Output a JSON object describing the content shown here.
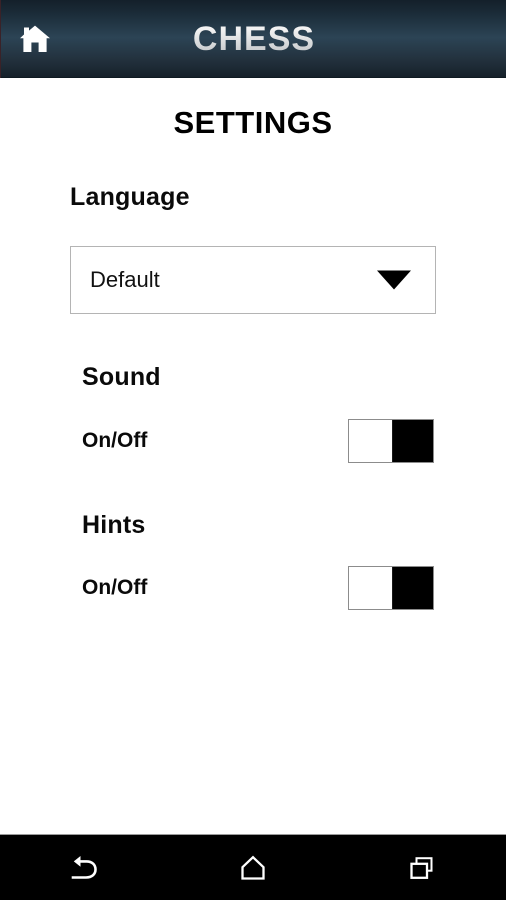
{
  "header": {
    "title": "CHESS",
    "home_icon": "home-icon",
    "bg_top_color": "#14202a",
    "bg_mid_color": "#2c4455",
    "bg_bottom_color": "#152029"
  },
  "page": {
    "title": "SETTINGS",
    "background": "#ffffff",
    "text_color": "#000000"
  },
  "sections": {
    "language": {
      "heading": "Language",
      "select": {
        "value": "Default",
        "placeholder": "Default",
        "chevron_icon": "chevron-down-icon",
        "border_color": "#b4b4b4"
      }
    },
    "sound": {
      "heading": "Sound",
      "row_label": "On/Off",
      "toggle": {
        "state": "on",
        "thumb_color": "#ffffff",
        "track_color": "#000000"
      }
    },
    "hints": {
      "heading": "Hints",
      "row_label": "On/Off",
      "toggle": {
        "state": "on",
        "thumb_color": "#ffffff",
        "track_color": "#000000"
      }
    }
  },
  "nav_bar": {
    "background": "#000000",
    "icon_color": "#ffffff",
    "buttons": [
      {
        "name": "back-icon",
        "label": "Back"
      },
      {
        "name": "home-icon",
        "label": "Home"
      },
      {
        "name": "recents-icon",
        "label": "Recents"
      }
    ]
  }
}
